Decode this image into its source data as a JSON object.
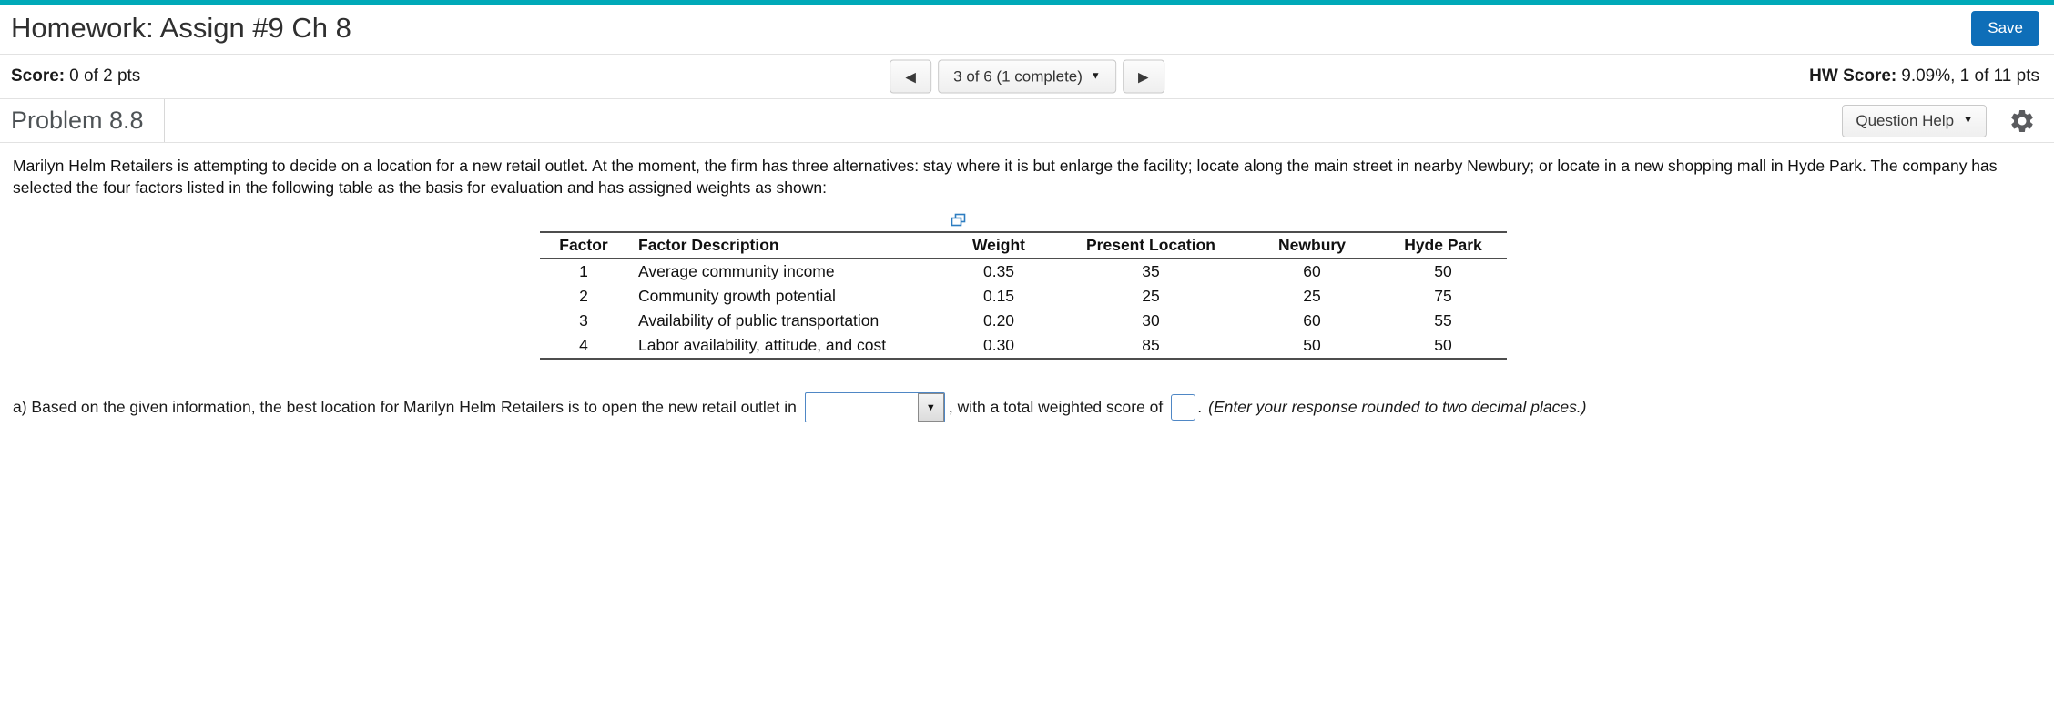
{
  "colors": {
    "accent_teal": "#00a9b8",
    "primary_blue": "#0e6eb8",
    "answer_border_blue": "#4f87c5"
  },
  "icons": {
    "prev": "◀",
    "next": "▶",
    "dropdown": "▼"
  },
  "header": {
    "title": "Homework: Assign #9 Ch 8",
    "save_label": "Save"
  },
  "score_bar": {
    "score_label": "Score:",
    "score_value": "0 of 2 pts",
    "pagination_label": "3 of 6 (1 complete)",
    "hw_score_label": "HW Score:",
    "hw_score_value": "9.09%, 1 of 11 pts"
  },
  "problem": {
    "title": "Problem 8.8",
    "question_help_label": "Question Help"
  },
  "content": {
    "paragraph": "Marilyn Helm Retailers is attempting to decide on a location for a new retail outlet. At the moment, the firm has three alternatives: stay where it is but enlarge the facility; locate along the main street in nearby Newbury; or locate in a new shopping mall in Hyde Park. The company has selected the four factors listed in the following table as the basis for evaluation and has assigned weights as shown:",
    "table": {
      "headers": [
        "Factor",
        "Factor Description",
        "Weight",
        "Present Location",
        "Newbury",
        "Hyde Park"
      ],
      "rows": [
        [
          "1",
          "Average community income",
          "0.35",
          "35",
          "60",
          "50"
        ],
        [
          "2",
          "Community growth potential",
          "0.15",
          "25",
          "25",
          "75"
        ],
        [
          "3",
          "Availability of public transportation",
          "0.20",
          "30",
          "60",
          "55"
        ],
        [
          "4",
          "Labor availability, attitude, and cost",
          "0.30",
          "85",
          "50",
          "50"
        ]
      ]
    },
    "question": {
      "prefix": "a) Based on the given information, the best location for Marilyn Helm Retailers is to open the new retail outlet in",
      "middle": ", with a total weighted score of",
      "period": ".",
      "hint": "(Enter your response rounded to two decimal places.)"
    }
  }
}
